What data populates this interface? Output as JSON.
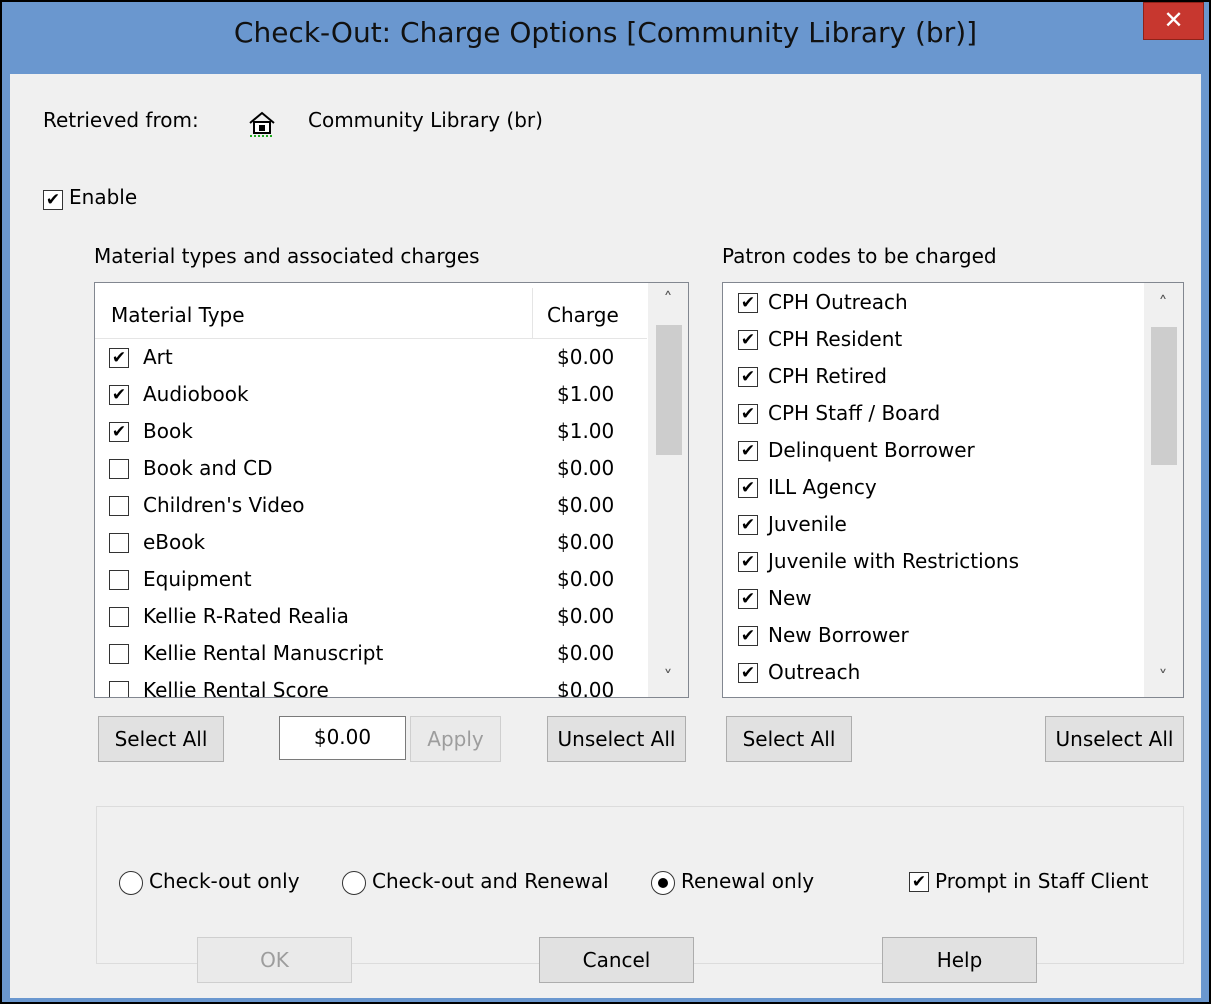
{
  "window": {
    "title": "Check-Out: Charge Options [Community Library  (br)]",
    "close_glyph": "✕"
  },
  "retrieved": {
    "label": "Retrieved from:",
    "icon": "library-building-icon",
    "value": "Community Library  (br)"
  },
  "enable": {
    "label": "Enable",
    "checked": true
  },
  "materials": {
    "heading": "Material types and associated charges",
    "col_type": "Material Type",
    "col_charge": "Charge",
    "rows": [
      {
        "name": "Art",
        "charge": "$0.00",
        "checked": true
      },
      {
        "name": "Audiobook",
        "charge": "$1.00",
        "checked": true
      },
      {
        "name": "Book",
        "charge": "$1.00",
        "checked": true
      },
      {
        "name": "Book and CD",
        "charge": "$0.00",
        "checked": false
      },
      {
        "name": "Children's Video",
        "charge": "$0.00",
        "checked": false
      },
      {
        "name": "eBook",
        "charge": "$0.00",
        "checked": false
      },
      {
        "name": "Equipment",
        "charge": "$0.00",
        "checked": false
      },
      {
        "name": "Kellie R-Rated Realia",
        "charge": "$0.00",
        "checked": false
      },
      {
        "name": "Kellie Rental Manuscript",
        "charge": "$0.00",
        "checked": false
      },
      {
        "name": "Kellie Rental Score",
        "charge": "$0.00",
        "checked": false
      }
    ],
    "select_all": "Select All",
    "charge_value": "$0.00",
    "apply": "Apply",
    "unselect_all": "Unselect All"
  },
  "patrons": {
    "heading": "Patron codes to be charged",
    "rows": [
      {
        "name": "CPH Outreach",
        "checked": true
      },
      {
        "name": "CPH Resident",
        "checked": true
      },
      {
        "name": "CPH Retired",
        "checked": true
      },
      {
        "name": "CPH Staff / Board",
        "checked": true
      },
      {
        "name": "Delinquent Borrower",
        "checked": true
      },
      {
        "name": "ILL Agency",
        "checked": true
      },
      {
        "name": "Juvenile",
        "checked": true
      },
      {
        "name": "Juvenile with Restrictions",
        "checked": true
      },
      {
        "name": "New",
        "checked": true
      },
      {
        "name": "New Borrower",
        "checked": true
      },
      {
        "name": "Outreach",
        "checked": true
      }
    ],
    "select_all": "Select All",
    "unselect_all": "Unselect All"
  },
  "options": {
    "checkout_only": "Check-out only",
    "checkout_renewal": "Check-out and Renewal",
    "renewal_only": "Renewal only",
    "selected": "renewal_only",
    "prompt": {
      "label": "Prompt in Staff Client",
      "checked": true
    }
  },
  "buttons": {
    "ok": "OK",
    "cancel": "Cancel",
    "help": "Help"
  },
  "scroll_glyphs": {
    "up": "˄",
    "down": "˅"
  }
}
